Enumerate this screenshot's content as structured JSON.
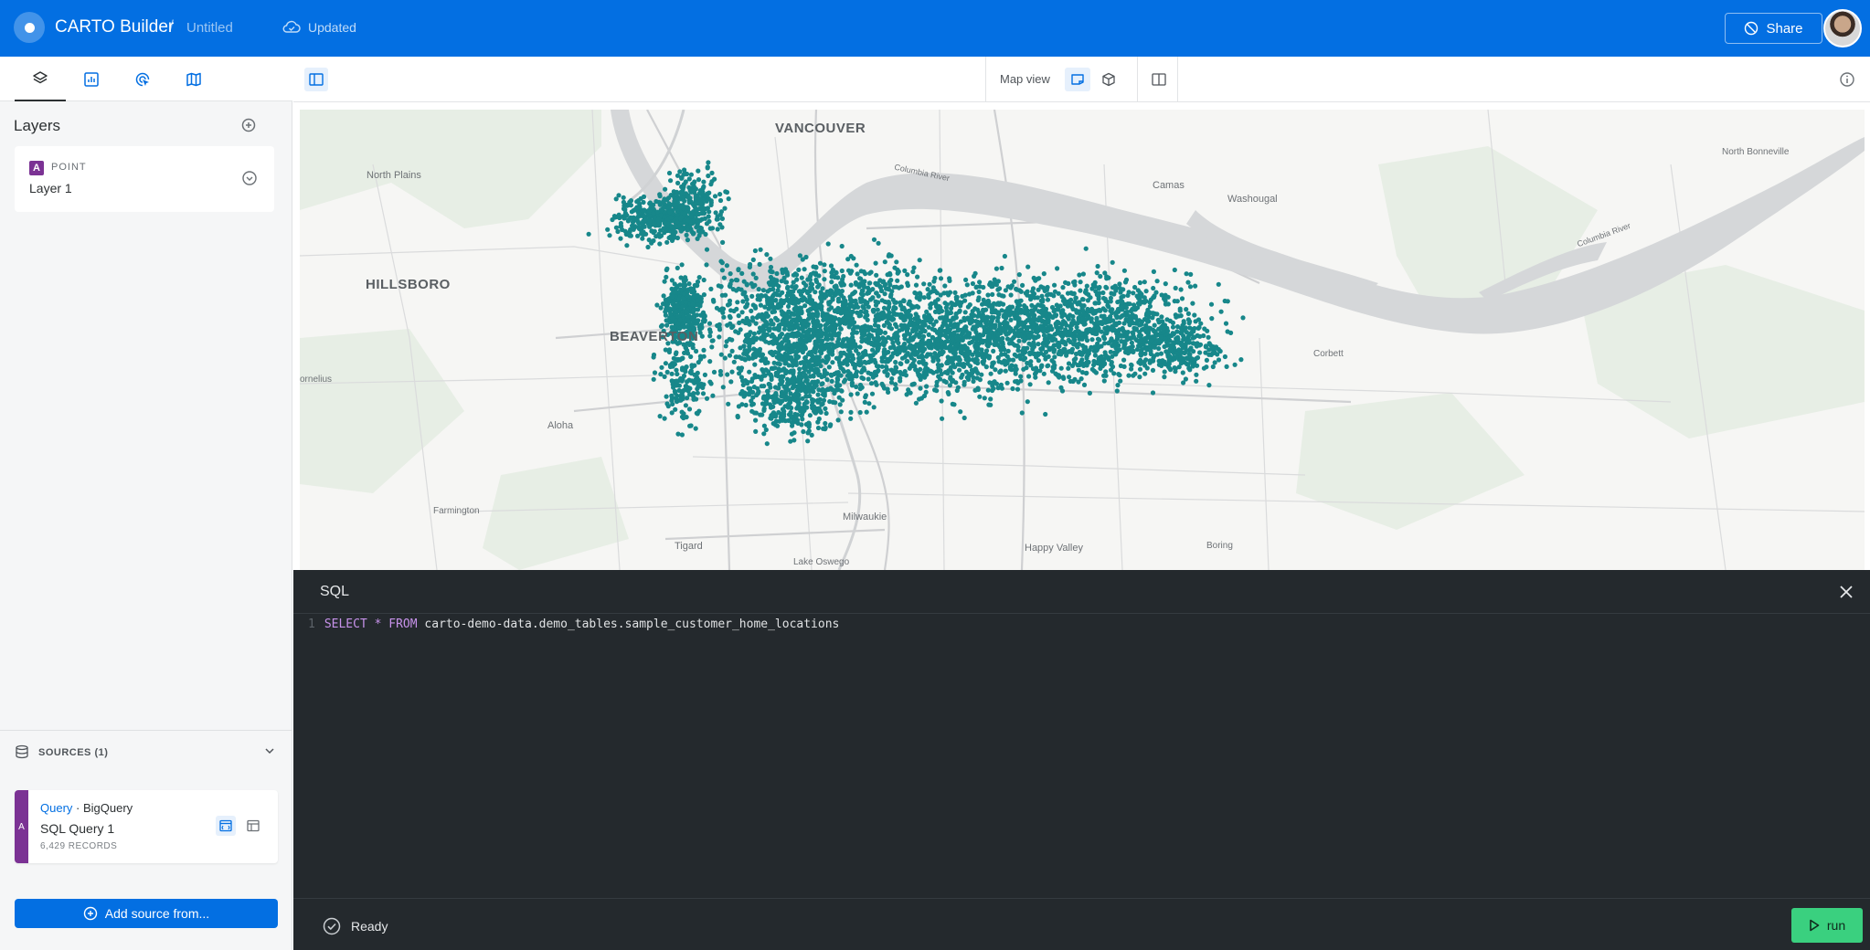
{
  "header": {
    "app_title": "CARTO Builder",
    "separator": "/",
    "map_title": "Untitled",
    "status": "Updated",
    "share_label": "Share",
    "brand_color": "#036fe2"
  },
  "left_panel": {
    "tabs": [
      {
        "icon": "layers-icon"
      },
      {
        "icon": "widgets-icon"
      },
      {
        "icon": "interactions-icon"
      },
      {
        "icon": "basemap-icon"
      }
    ],
    "layers_title": "Layers",
    "layers": [
      {
        "badge": "A",
        "type": "POINT",
        "name": "Layer 1",
        "color": "#7b3294"
      }
    ],
    "sources_label": "SOURCES (1)",
    "sources": [
      {
        "badge": "A",
        "type_link": "Query",
        "connector": " · BigQuery",
        "name": "SQL Query 1",
        "records": "6,429 RECORDS"
      }
    ],
    "add_source_label": "Add source from..."
  },
  "map_toolbar": {
    "map_view_label": "Map view"
  },
  "map": {
    "point_color": "#17878a",
    "labels": {
      "vancouver": "VANCOUVER",
      "hillsboro": "HILLSBORO",
      "beaverton": "BEAVERTON",
      "north_plains": "North Plains",
      "camas": "Camas",
      "washougal": "Washougal",
      "north_bonneville": "North Bonneville",
      "corbett": "Corbett",
      "aloha": "Aloha",
      "farmington": "Farmington",
      "tigard": "Tigard",
      "milwaukie": "Milwaukie",
      "lake_oswego": "Lake Oswego",
      "happy_valley": "Happy Valley",
      "boring": "Boring",
      "cornelius": "ornelius",
      "columbia_river": "Columbia River"
    }
  },
  "sql_panel": {
    "title": "SQL",
    "line_number": "1",
    "code_kw1": "SELECT",
    "code_star": " * ",
    "code_kw2": "FROM",
    "code_rest": " carto-demo-data.demo_tables.sample_customer_home_locations",
    "status": "Ready",
    "run_label": "run"
  }
}
